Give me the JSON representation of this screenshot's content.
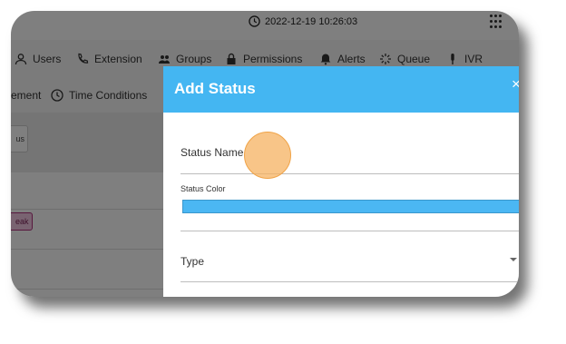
{
  "topbar": {
    "datetime": "2022-12-19 10:26:03"
  },
  "nav_primary": [
    "Users",
    "Extension",
    "Groups",
    "Permissions",
    "Alerts",
    "Queue",
    "IVR"
  ],
  "nav_secondary": [
    "ement",
    "Time Conditions"
  ],
  "toolbar": {
    "button_partial": "us"
  },
  "table": {
    "badge_partial": "eak"
  },
  "modal": {
    "title": "Add Status",
    "close": "×",
    "status_name_label": "Status Name",
    "status_color_label": "Status Color",
    "status_color_value": "#4bb7f3",
    "type_label": "Type"
  },
  "colors": {
    "modal_header": "#44b6f2",
    "overlay": "rgba(0,0,0,0.5)",
    "badge": "#f3c7e2"
  }
}
